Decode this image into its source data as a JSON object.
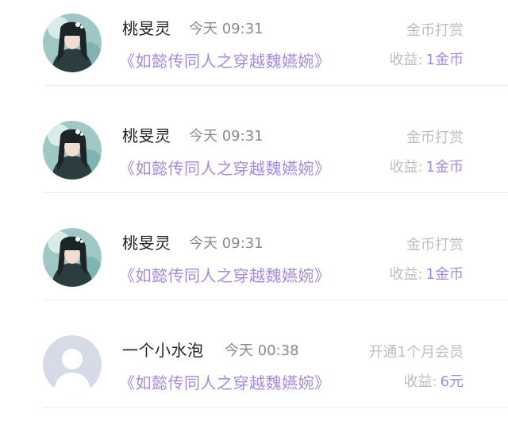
{
  "records": [
    {
      "avatar_icon": "character-portrait-avatar",
      "name": "桃旻灵",
      "time": "今天 09:31",
      "book": "《如懿传同人之穿越魏嬿婉》",
      "type": "金币打赏",
      "income_label": "收益:",
      "income_value": "1金币"
    },
    {
      "avatar_icon": "character-portrait-avatar",
      "name": "桃旻灵",
      "time": "今天 09:31",
      "book": "《如懿传同人之穿越魏嬿婉》",
      "type": "金币打赏",
      "income_label": "收益:",
      "income_value": "1金币"
    },
    {
      "avatar_icon": "character-portrait-avatar",
      "name": "桃旻灵",
      "time": "今天 09:31",
      "book": "《如懿传同人之穿越魏嬿婉》",
      "type": "金币打赏",
      "income_label": "收益:",
      "income_value": "1金币"
    },
    {
      "avatar_icon": "default-user-avatar",
      "name": "一个小水泡",
      "time": "今天 00:38",
      "book": "《如懿传同人之穿越魏嬿婉》",
      "type": "开通1个月会员",
      "income_label": "收益:",
      "income_value": "6元"
    }
  ],
  "colors": {
    "accent": "#a58adb",
    "muted": "#bdbdbd",
    "time": "#8a8a8a",
    "name": "#222222"
  }
}
